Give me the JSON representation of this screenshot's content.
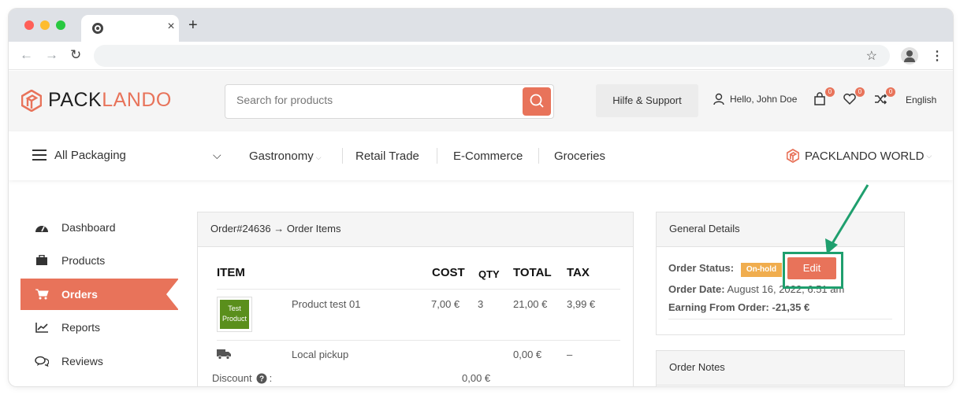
{
  "browser": {
    "tab_close": "×",
    "new_tab": "+",
    "back": "←",
    "forward": "→",
    "reload": "↻",
    "star": "☆",
    "menu": "⋮",
    "dot_colors": [
      "#ff5f57",
      "#febc2e",
      "#28c840"
    ]
  },
  "header": {
    "logo_part1": "PACK",
    "logo_part2": "LANDO",
    "search_placeholder": "Search for products",
    "support_label": "Hilfe & Support",
    "greeting": "Hello, John Doe",
    "cart_count": "0",
    "wishlist_count": "0",
    "compare_count": "0",
    "language": "English"
  },
  "catnav": {
    "all_label": "All Packaging",
    "links": [
      "Gastronomy",
      "Retail Trade",
      "E-Commerce",
      "Groceries"
    ],
    "world_label": "PACKLANDO WORLD"
  },
  "sidebar": {
    "items": [
      {
        "label": "Dashboard",
        "icon": "dashboard-icon"
      },
      {
        "label": "Products",
        "icon": "briefcase-icon"
      },
      {
        "label": "Orders",
        "icon": "cart-icon"
      },
      {
        "label": "Reports",
        "icon": "chart-icon"
      },
      {
        "label": "Reviews",
        "icon": "comments-icon"
      }
    ]
  },
  "order": {
    "title": "Order#24636 → Order Items",
    "headers": {
      "item": "ITEM",
      "cost": "COST",
      "qty": "QTY",
      "total": "TOTAL",
      "tax": "TAX"
    },
    "thumb_text": "Test Product",
    "product": {
      "name": "Product test 01",
      "cost": "7,00 €",
      "qty": "3",
      "total": "21,00 €",
      "tax": "3,99 €"
    },
    "shipping": {
      "name": "Local pickup",
      "total": "0,00 €",
      "tax": "–"
    },
    "discount_label": "Discount",
    "discount_suffix": ":",
    "discount_value": "0,00 €"
  },
  "details": {
    "title": "General Details",
    "status_label": "Order Status:",
    "status_badge": "On-hold",
    "edit_label": "Edit",
    "date_label": "Order Date:",
    "date_value": "August 16, 2022, 6:51 am",
    "earning_label": "Earning From Order:",
    "earning_value": "-21,35 €",
    "notes_title": "Order Notes"
  },
  "colors": {
    "accent": "#e8735a",
    "highlight": "#1f9f6e",
    "status_onhold": "#f0ad4e"
  }
}
